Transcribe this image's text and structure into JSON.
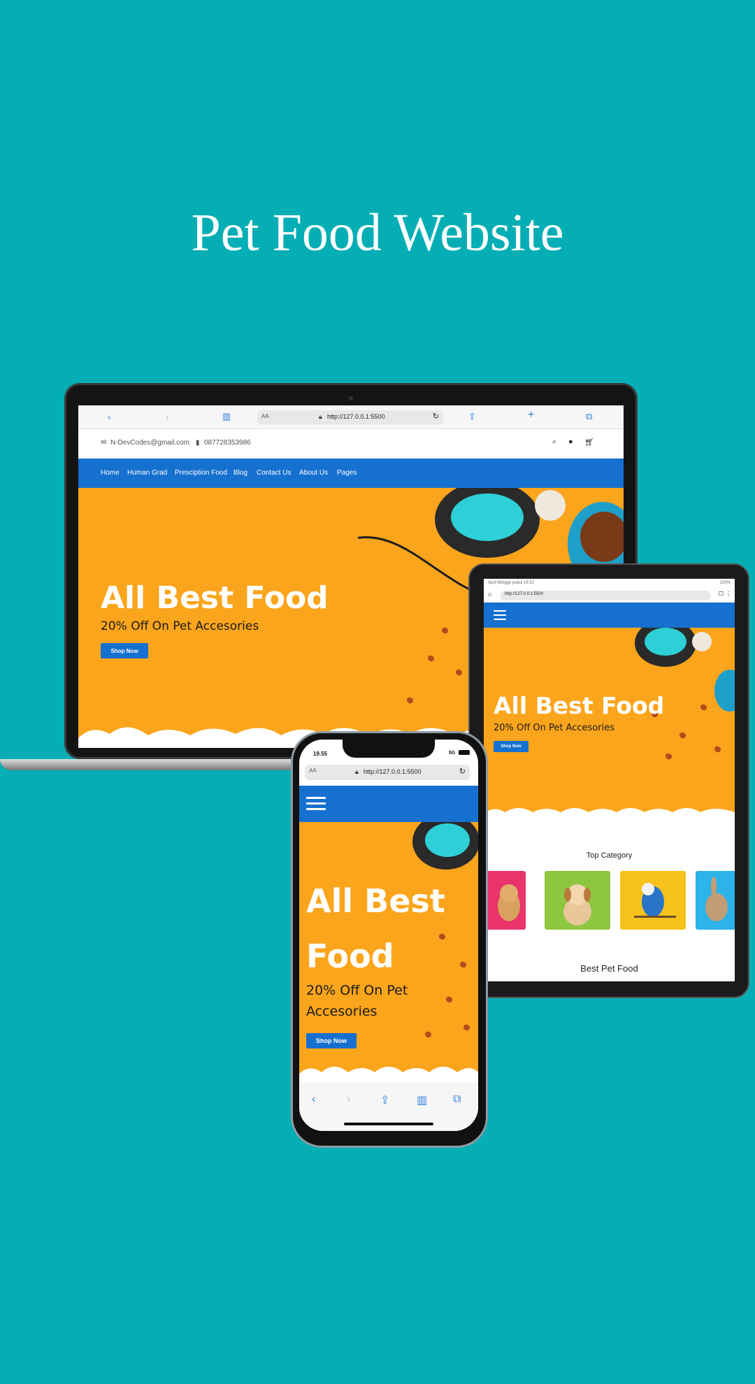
{
  "title": "Pet Food Website",
  "colors": {
    "background": "#04aeb4",
    "nav_blue": "#1670cf",
    "hero_orange": "#fba51c"
  },
  "laptop": {
    "url": "http://127.0.0.1:5500",
    "url_prefix": "AA",
    "email": "N-DevCodes@gmail.com",
    "phone": "087728353986",
    "nav": [
      "Home",
      "Human Grad",
      "Presciption Food",
      "Blog",
      "Contact Us",
      "About Us",
      "Pages"
    ],
    "hero": {
      "title": "All Best Food",
      "subtitle": "20% Off On Pet Accesories",
      "button": "Shop Now"
    }
  },
  "tablet": {
    "status_left": "April Minggu pukul 19.52",
    "status_right": "100%",
    "url": "http://127.0.0.1:5500",
    "hero": {
      "title": "All Best Food",
      "subtitle": "20% Off On Pet Accesories",
      "button": "Shop Now"
    },
    "top_category": "Top Category",
    "categories": [
      "cat",
      "dog",
      "parrot",
      "rabbit"
    ],
    "best_pet_food": "Best Pet Food"
  },
  "phone": {
    "time": "19.55",
    "network": "5G",
    "url_prefix": "AA",
    "url": "http://127.0.0.1:5500",
    "hero": {
      "title_line1": "All Best",
      "title_line2": "Food",
      "subtitle_line1": "20% Off On Pet",
      "subtitle_line2": "Accesories",
      "button": "Shop Now"
    }
  }
}
